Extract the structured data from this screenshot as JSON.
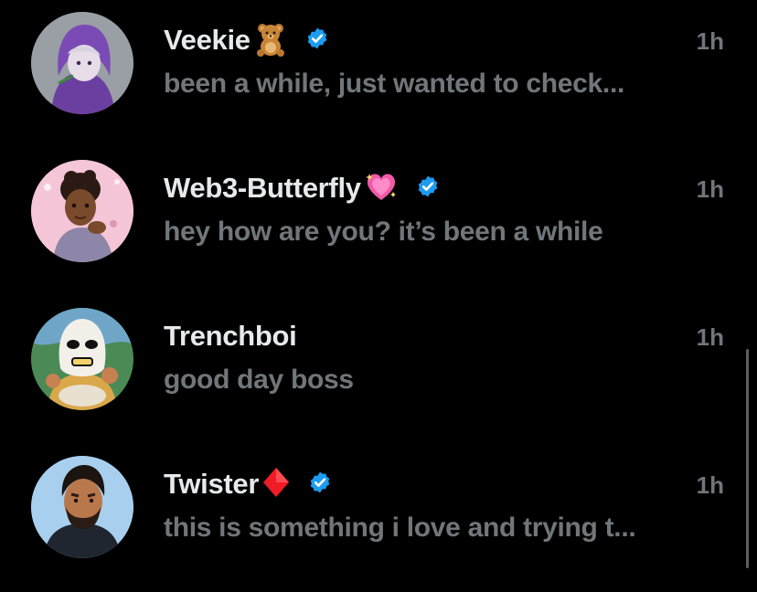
{
  "conversations": [
    {
      "name": "Veekie",
      "emoji": "teddy-bear",
      "verified": true,
      "time": "1h",
      "preview": "been a while, just wanted to check...",
      "avatar": "purple-hoodie-avatar"
    },
    {
      "name": "Web3-Butterfly",
      "emoji": "sparkling-heart",
      "verified": true,
      "time": "1h",
      "preview": "hey how are you? it’s been a while",
      "avatar": "pink-background-avatar"
    },
    {
      "name": "Trenchboi",
      "emoji": "",
      "verified": false,
      "time": "1h",
      "preview": "good day boss",
      "avatar": "ski-mask-avatar"
    },
    {
      "name": "Twister",
      "emoji": "red-diamond",
      "verified": true,
      "time": "1h",
      "preview": "this is something i love and trying t...",
      "avatar": "man-with-beard-avatar"
    }
  ],
  "colors": {
    "background": "#000000",
    "name": "#e7e9ea",
    "secondary": "#71767b",
    "verified": "#1d9bf0"
  }
}
